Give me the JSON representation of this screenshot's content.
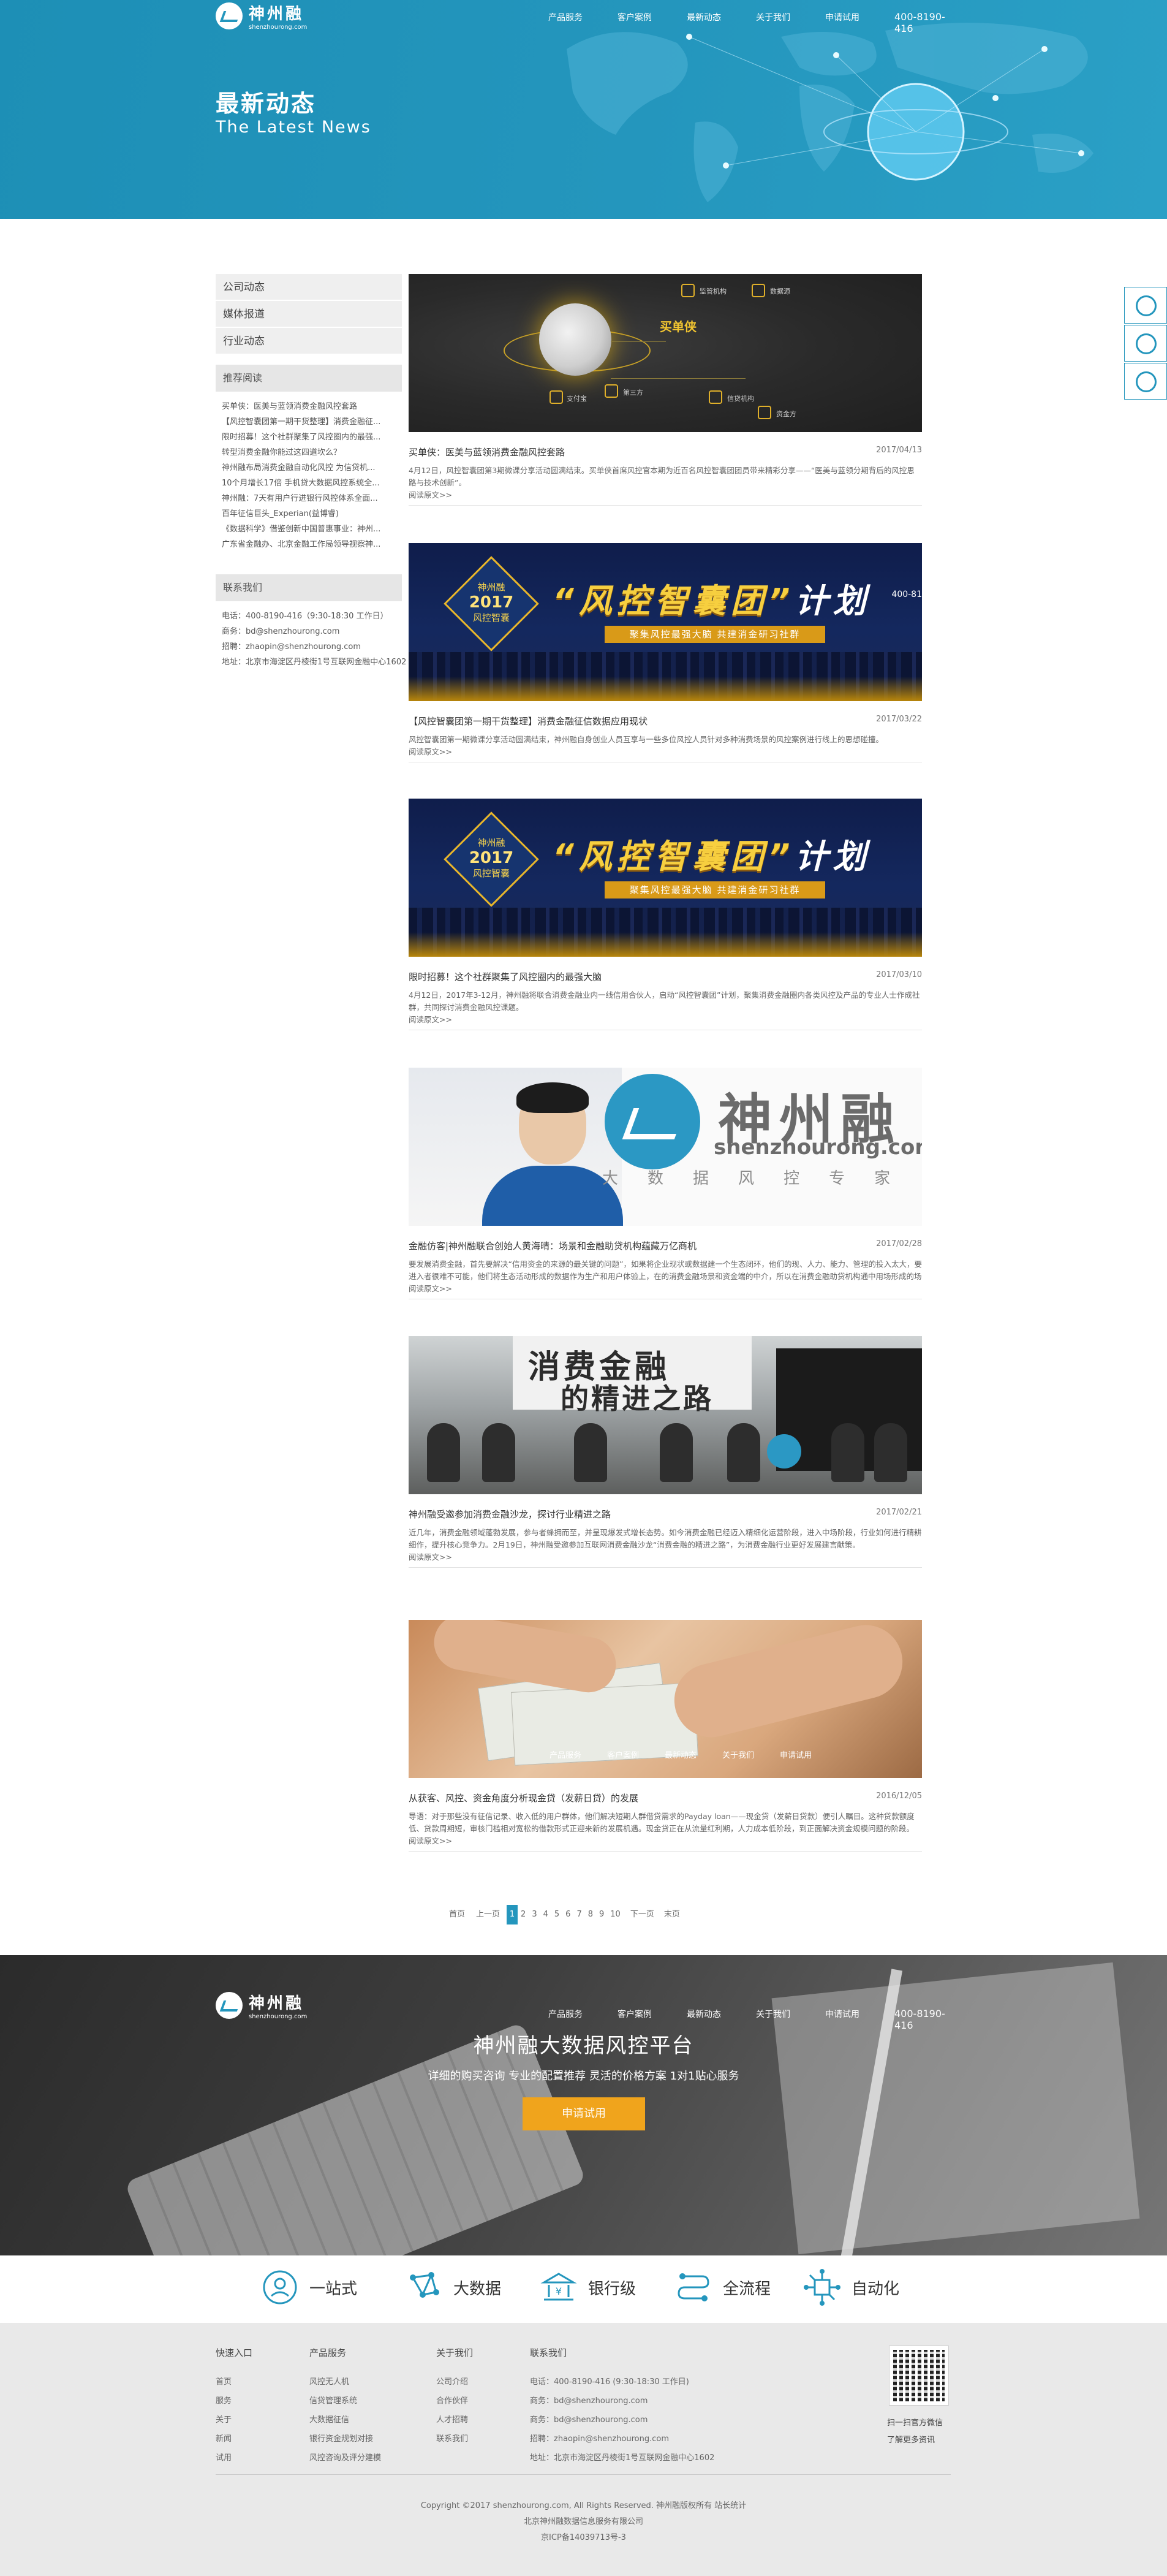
{
  "header": {
    "logo_cn": "神州融",
    "logo_en": "shenzhourong.com",
    "nav": [
      "产品服务",
      "客户案例",
      "最新动态",
      "关于我们",
      "申请试用"
    ],
    "phone": "400-8190-416",
    "title": "最新动态",
    "subtitle": "The Latest News"
  },
  "sidebar": {
    "categories": [
      "公司动态",
      "媒体报道",
      "行业动态"
    ],
    "recommend_title": "推荐阅读",
    "recommend": [
      "买单侠：医美与蓝领消费金融风控套路",
      "【风控智囊团第一期干货整理】消费金融征...",
      "限时招募！这个社群聚集了风控圈内的最强...",
      "转型消费金融你能过这四道坎么？",
      "神州融布局消费金融自动化风控 为信贷机...",
      "10个月增长17倍 手机贷大数据风控系统全...",
      "神州融：7天有用户行进银行风控体系全面...",
      "百年征信巨头_Experian(益博睿)",
      "《数据科学》借鉴创新中国普惠事业：神州...",
      "广东省金融办、北京金融工作局领导视察神..."
    ],
    "contact_title": "联系我们",
    "contact": [
      "电话：400-8190-416（9:30-18:30 工作日）",
      "商务：bd@shenzhourong.com",
      "招聘：zhaopin@shenzhourong.com",
      "地址：北京市海淀区丹棱街1号互联网金融中心1602"
    ]
  },
  "articles": [
    {
      "title": "买单侠：医美与蓝领消费金融风控套路",
      "date": "2017/04/13",
      "summary": "4月12日，风控智囊团第3期微课分享活动圆满结束。买单侠首席风控官本期为近百名风控智囊团团员带来精彩分享——“医美与蓝领分期背后的风控思路与技术创新”。",
      "more": "阅读原文>>",
      "image": {
        "brand": "买单侠",
        "nodes": [
          "监管机构",
          "数据源",
          "支付宝",
          "第三方",
          "信贷机构",
          "资金方"
        ]
      }
    },
    {
      "title": "【风控智囊团第一期干货整理】消费金融征信数据应用现状",
      "date": "2017/03/22",
      "summary": "风控智囊团第一期微课分享活动圆满结束，神州融自身创业人员互享与一些多位风控人员针对多种消费场景的风控案例进行线上的思想碰撞。",
      "more": "阅读原文>>",
      "image": {
        "badge_top": "神州融",
        "badge_year": "2017",
        "badge_bottom": "风控智囊",
        "title": "风控智囊团",
        "title_suffix": "计划",
        "strip": "聚集风控最强大脑  共建消金研习社群",
        "phone": "400-81"
      }
    },
    {
      "title": "限时招募！这个社群聚集了风控圈内的最强大脑",
      "date": "2017/03/10",
      "summary": "4月12日，2017年3-12月，神州融将联合消费金融业内一线信用合伙人，启动“风控智囊团”计划，聚集消费金融圈内各类风控及产品的专业人士作成社群，共同探讨消费金融风控课题。",
      "more": "阅读原文>>",
      "image": {
        "badge_top": "神州融",
        "badge_year": "2017",
        "badge_bottom": "风控智囊",
        "title": "风控智囊团",
        "title_suffix": "计划",
        "strip": "聚集风控最强大脑  共建消金研习社群"
      }
    },
    {
      "title": "金融仿客|神州融联合创始人黄海晴：场景和金融助贷机构蕴藏万亿商机",
      "date": "2017/02/28",
      "summary": "要发展消费金融，首先要解决“信用资金的来源的最关键的问题”，如果将企业现状或数据建一个生态闭环，他们的现、人力、能力、管理的投入太大，要进入者很难不可能，他们将生态活动形成的数据作为生产和用户体验上，在的消费金融场景和资金端的中介，所以在消费金融助贷机构通中用场形成的场景和商业信息上得到的增益。",
      "more": "阅读原文>>",
      "image": {
        "logo_cn": "神州融",
        "logo_en": "shenzhourong.com",
        "tags": [
          "大",
          "数",
          "据",
          "风",
          "控",
          "专",
          "家"
        ]
      }
    },
    {
      "title": "神州融受邀参加消费金融沙龙，探讨行业精进之路",
      "date": "2017/02/21",
      "summary": "近几年，消费金融领域蓬勃发展，参与者蜂拥而至，并呈现爆发式增长态势。如今消费金融已经迈入精细化运营阶段，进入中场阶段，行业如何进行精耕细作，提升核心竞争力。2月19日，神州融受邀参加互联网消费金融沙龙“消费金融的精进之路”，为消费金融行业更好发展建言献策。",
      "more": "阅读原文>>",
      "image": {
        "line1": "消费金融",
        "line2": "的精进之路"
      }
    },
    {
      "title": "从获客、风控、资金角度分析现金贷（发薪日贷）的发展",
      "date": "2016/12/05",
      "summary": "导语：对于那些没有征信记录、收入低的用户群体，他们解决短期人群借贷需求的Payday loan——现金贷（发薪日贷款）便引人瞩目。这种贷款额度低、贷款周期短，审核门槛相对宽松的借款形式正迎来新的发展机遇。现金贷正在从流量红利期，人力成本低阶段，到正面解决资金规模问题的阶段。",
      "more": "阅读原文>>",
      "image": {
        "nav": [
          "产品服务",
          "客户案例",
          "最新动态",
          "关于我们",
          "申请试用"
        ]
      }
    }
  ],
  "pagination": {
    "first": "首页",
    "prev": "上一页",
    "current": "1",
    "pages": [
      "2",
      "3",
      "4",
      "5",
      "6",
      "7",
      "8",
      "9",
      "10"
    ],
    "next": "下一页",
    "last": "末页"
  },
  "cta": {
    "nav": [
      "产品服务",
      "客户案例",
      "最新动态",
      "关于我们",
      "申请试用"
    ],
    "phone": "400-8190-416",
    "title": "神州融大数据风控平台",
    "subtitle": "详细的购买咨询 专业的配置推荐 灵活的价格方案 1对1贴心服务",
    "button": "申请试用"
  },
  "features": [
    {
      "label": "一站式",
      "icon": "one-stop-icon"
    },
    {
      "label": "大数据",
      "icon": "big-data-icon"
    },
    {
      "label": "银行级",
      "icon": "bank-icon"
    },
    {
      "label": "全流程",
      "icon": "full-process-icon"
    },
    {
      "label": "自动化",
      "icon": "automation-icon"
    }
  ],
  "footer": {
    "quick_title": "快速入口",
    "quick": [
      "首页",
      "服务",
      "关于",
      "新闻",
      "试用"
    ],
    "product_title": "产品服务",
    "product": [
      "风控无人机",
      "信贷管理系统",
      "大数据征信",
      "银行资金规划对接",
      "风控咨询及评分建模"
    ],
    "about_title": "关于我们",
    "about": [
      "公司介绍",
      "合作伙伴",
      "人才招聘",
      "联系我们"
    ],
    "contact_title": "联系我们",
    "contact": [
      "电话：400-8190-416 (9:30-18:30 工作日)",
      "商务：bd@shenzhourong.com",
      "商务：bd@shenzhourong.com",
      "招聘：zhaopin@shenzhourong.com",
      "地址：北京市海淀区丹棱街1号互联网金融中心1602"
    ],
    "qr_text_1": "扫一扫官方微信",
    "qr_text_2": "了解更多资讯",
    "copyright": "Copyright ©2017 shenzhourong.com, All Rights Reserved. 神州融版权所有 站长统计",
    "company": "北京神州融数据信息服务有限公司",
    "icp": "京ICP备14039713号-3"
  },
  "colors": {
    "brand": "#2496bd",
    "accent": "#f0a41c"
  }
}
